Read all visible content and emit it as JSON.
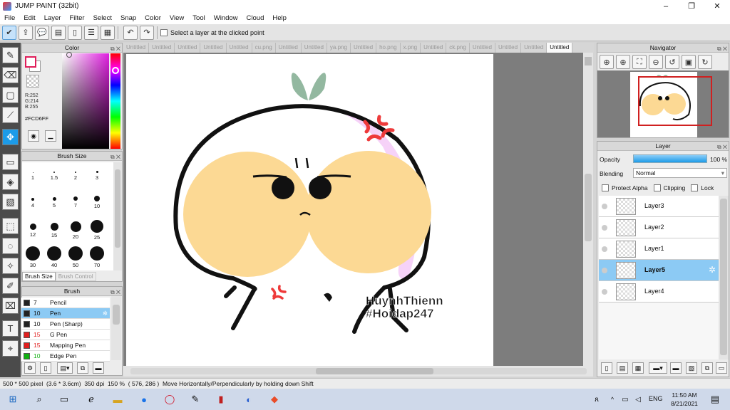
{
  "window": {
    "title": "JUMP PAINT (32bit)",
    "controls": [
      "–",
      "❐",
      "✕"
    ]
  },
  "menu": [
    "File",
    "Edit",
    "Layer",
    "Filter",
    "Select",
    "Snap",
    "Color",
    "View",
    "Tool",
    "Window",
    "Cloud",
    "Help"
  ],
  "toolbar": {
    "select_layer_label": "Select a layer at the clicked point"
  },
  "doc_tabs": [
    "Untitled",
    "Untitled",
    "Untitled",
    "Untitled",
    "Untitled",
    "cu.png",
    "Untitled",
    "Untitled",
    "ya.png",
    "Untitled",
    "ho.png",
    "x.png",
    "Untitled",
    "ck.png",
    "Untitled",
    "Untitled",
    "Untitled",
    "Untitled"
  ],
  "color_panel": {
    "title": "Color",
    "r": "R:252",
    "g": "G:214",
    "b": "B:255",
    "hex": "#FCD6FF",
    "accent": "#FCD6FF"
  },
  "brush_size_panel": {
    "title": "Brush Size",
    "sizes": [
      "1",
      "1.5",
      "2",
      "3",
      "4",
      "5",
      "7",
      "10",
      "12",
      "15",
      "20",
      "25",
      "30",
      "40",
      "50",
      "70"
    ],
    "tabs": [
      "Brush Size",
      "Brush Control"
    ]
  },
  "brush_panel": {
    "title": "Brush",
    "items": [
      {
        "size": "7",
        "name": "Pencil",
        "color": "#222222"
      },
      {
        "size": "10",
        "name": "Pen",
        "color": "#222222"
      },
      {
        "size": "10",
        "name": "Pen (Sharp)",
        "color": "#222222"
      },
      {
        "size": "15",
        "name": "G Pen",
        "color": "#e02020"
      },
      {
        "size": "15",
        "name": "Mapping Pen",
        "color": "#e02020"
      },
      {
        "size": "10",
        "name": "Edge Pen",
        "color": "#10b010"
      }
    ]
  },
  "canvas": {
    "watermark_line1": "HuynhThienn",
    "watermark_line2": "#Hoidap247"
  },
  "navigator": {
    "title": "Navigator"
  },
  "layer_panel": {
    "title": "Layer",
    "opacity_label": "Opacity",
    "opacity_value": "100 %",
    "opacity_level": 1.0,
    "blending_label": "Blending",
    "blending_value": "Normal",
    "protect_alpha": "Protect Alpha",
    "clipping": "Clipping",
    "lock": "Lock",
    "layers": [
      "Layer3",
      "Layer2",
      "Layer1",
      "Layer5",
      "Layer4"
    ],
    "selected": "Layer5"
  },
  "status": {
    "text": "500 * 500 pixel  (3.6 * 3.6cm)  350 dpi  150 %  ( 576, 286 )  Move Horizontally/Perpendicularly by holding down Shift"
  },
  "taskbar": {
    "time": "11:50 AM",
    "date": "8/21/2021",
    "lang": "ENG"
  }
}
